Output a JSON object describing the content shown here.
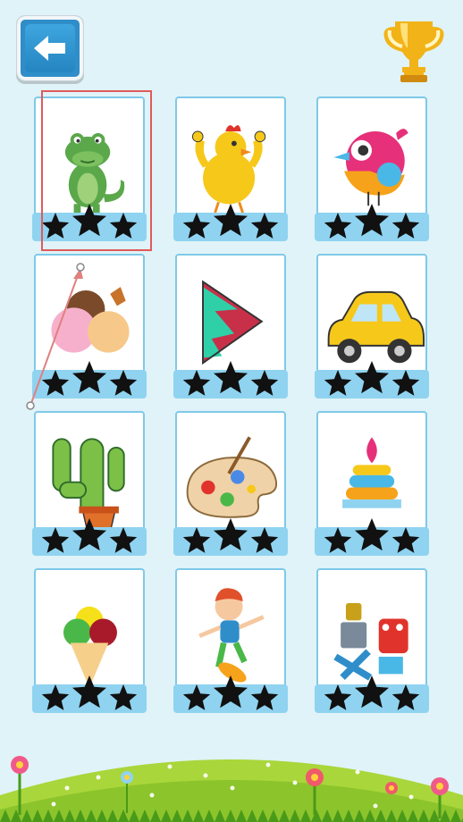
{
  "header": {
    "back_button_icon": "back-arrow-icon",
    "trophy_icon": "trophy-icon"
  },
  "colors": {
    "background": "#dff3f8",
    "card_border": "#7fc9e8",
    "star_bar": "#8fd3f0",
    "back_button": "#2f8ec9",
    "highlight": "#e05a5a"
  },
  "levels": [
    {
      "icon": "crocodile-icon",
      "stars_earned": 0,
      "stars_total": 3
    },
    {
      "icon": "chicken-icon",
      "stars_earned": 0,
      "stars_total": 3
    },
    {
      "icon": "bird-icon",
      "stars_earned": 0,
      "stars_total": 3
    },
    {
      "icon": "ice-cream-scoops-icon",
      "stars_earned": 0,
      "stars_total": 3
    },
    {
      "icon": "triangle-shape-icon",
      "stars_earned": 0,
      "stars_total": 3
    },
    {
      "icon": "car-icon",
      "stars_earned": 0,
      "stars_total": 3
    },
    {
      "icon": "cactus-icon",
      "stars_earned": 0,
      "stars_total": 3
    },
    {
      "icon": "paint-palette-icon",
      "stars_earned": 0,
      "stars_total": 3
    },
    {
      "icon": "stacking-rings-toy-icon",
      "stars_earned": 0,
      "stars_total": 3
    },
    {
      "icon": "ice-cream-cone-icon",
      "stars_earned": 0,
      "stars_total": 3
    },
    {
      "icon": "skateboard-boy-icon",
      "stars_earned": 0,
      "stars_total": 3
    },
    {
      "icon": "toy-robots-icon",
      "stars_earned": 0,
      "stars_total": 3
    }
  ],
  "selected_level_index": 0
}
